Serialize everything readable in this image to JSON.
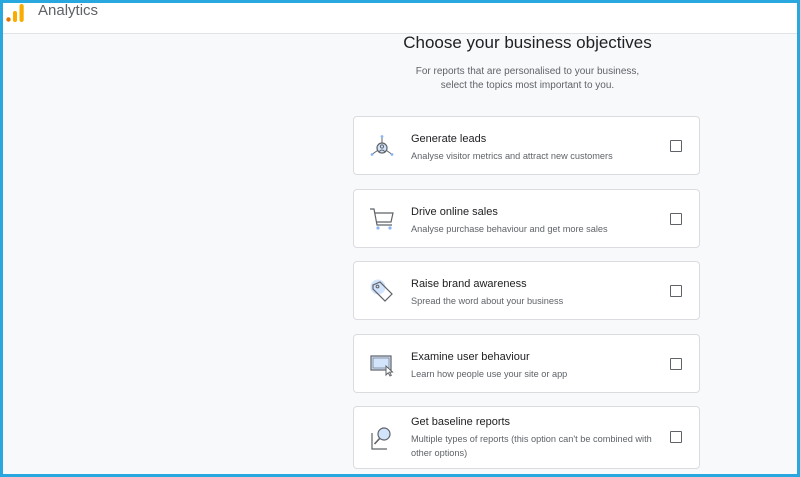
{
  "header": {
    "app_title": "Analytics",
    "brand_colors": [
      "#f9ab00",
      "#e37400"
    ]
  },
  "main": {
    "heading": "Choose your business objectives",
    "subheading_line1": "For reports that are personalised to your business,",
    "subheading_line2": "select the topics most important to you.",
    "options": [
      {
        "title": "Generate leads",
        "description": "Analyse visitor metrics and attract new customers",
        "icon": "leads-icon",
        "checked": false
      },
      {
        "title": "Drive online sales",
        "description": "Analyse purchase behaviour and get more sales",
        "icon": "shopping-cart-icon",
        "checked": false
      },
      {
        "title": "Raise brand awareness",
        "description": "Spread the word about your business",
        "icon": "tag-icon",
        "checked": false
      },
      {
        "title": "Examine user behaviour",
        "description": "Learn how people use your site or app",
        "icon": "screen-cursor-icon",
        "checked": false
      },
      {
        "title": "Get baseline reports",
        "description": "Multiple types of reports (this option can't be combined with other options)",
        "icon": "magnifier-icon",
        "checked": false
      }
    ]
  }
}
